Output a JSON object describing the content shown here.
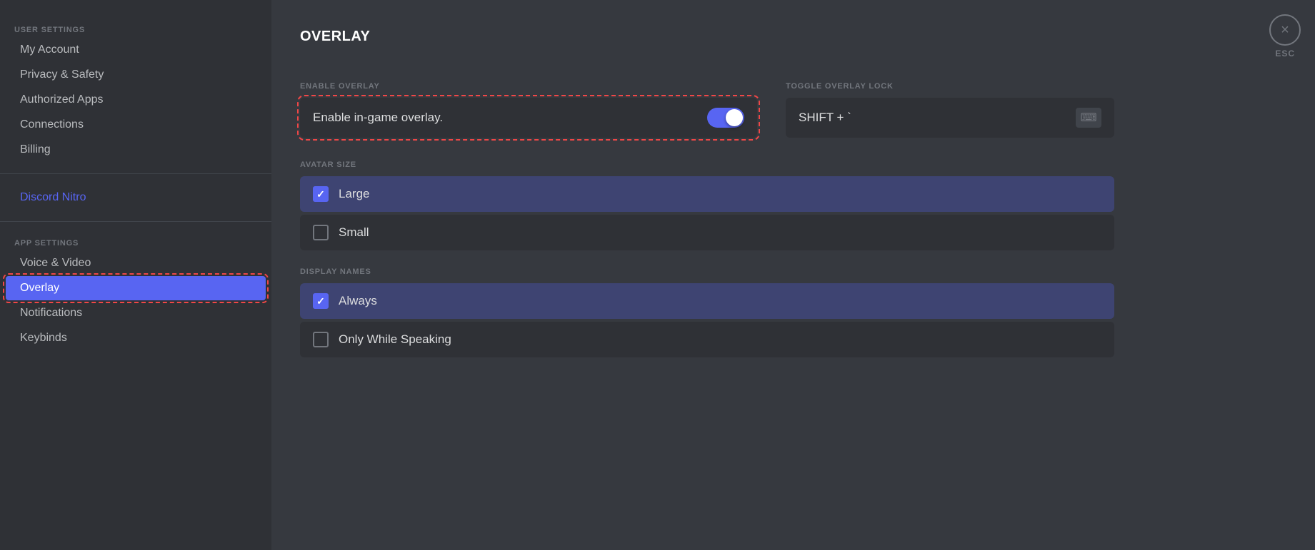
{
  "sidebar": {
    "user_settings_label": "USER SETTINGS",
    "app_settings_label": "APP SETTINGS",
    "items": [
      {
        "id": "my-account",
        "label": "My Account",
        "active": false,
        "nitro": false
      },
      {
        "id": "privacy-safety",
        "label": "Privacy & Safety",
        "active": false,
        "nitro": false
      },
      {
        "id": "authorized-apps",
        "label": "Authorized Apps",
        "active": false,
        "nitro": false
      },
      {
        "id": "connections",
        "label": "Connections",
        "active": false,
        "nitro": false
      },
      {
        "id": "billing",
        "label": "Billing",
        "active": false,
        "nitro": false
      },
      {
        "id": "discord-nitro",
        "label": "Discord Nitro",
        "active": false,
        "nitro": true
      },
      {
        "id": "voice-video",
        "label": "Voice & Video",
        "active": false,
        "nitro": false
      },
      {
        "id": "overlay",
        "label": "Overlay",
        "active": true,
        "nitro": false
      },
      {
        "id": "notifications",
        "label": "Notifications",
        "active": false,
        "nitro": false
      },
      {
        "id": "keybinds",
        "label": "Keybinds",
        "active": false,
        "nitro": false
      }
    ]
  },
  "main": {
    "page_title": "OVERLAY",
    "enable_overlay_section_label": "ENABLE OVERLAY",
    "toggle_lock_section_label": "TOGGLE OVERLAY LOCK",
    "enable_overlay_label": "Enable in-game overlay.",
    "toggle_enabled": true,
    "toggle_lock_value": "SHIFT + `",
    "avatar_size_section_label": "AVATAR SIZE",
    "avatar_size_options": [
      {
        "id": "large",
        "label": "Large",
        "selected": true
      },
      {
        "id": "small",
        "label": "Small",
        "selected": false
      }
    ],
    "display_names_section_label": "DISPLAY NAMES",
    "display_names_options": [
      {
        "id": "always",
        "label": "Always",
        "selected": true
      },
      {
        "id": "only-while-speaking",
        "label": "Only While Speaking",
        "selected": false
      }
    ]
  },
  "close_button_label": "×",
  "esc_label": "ESC"
}
